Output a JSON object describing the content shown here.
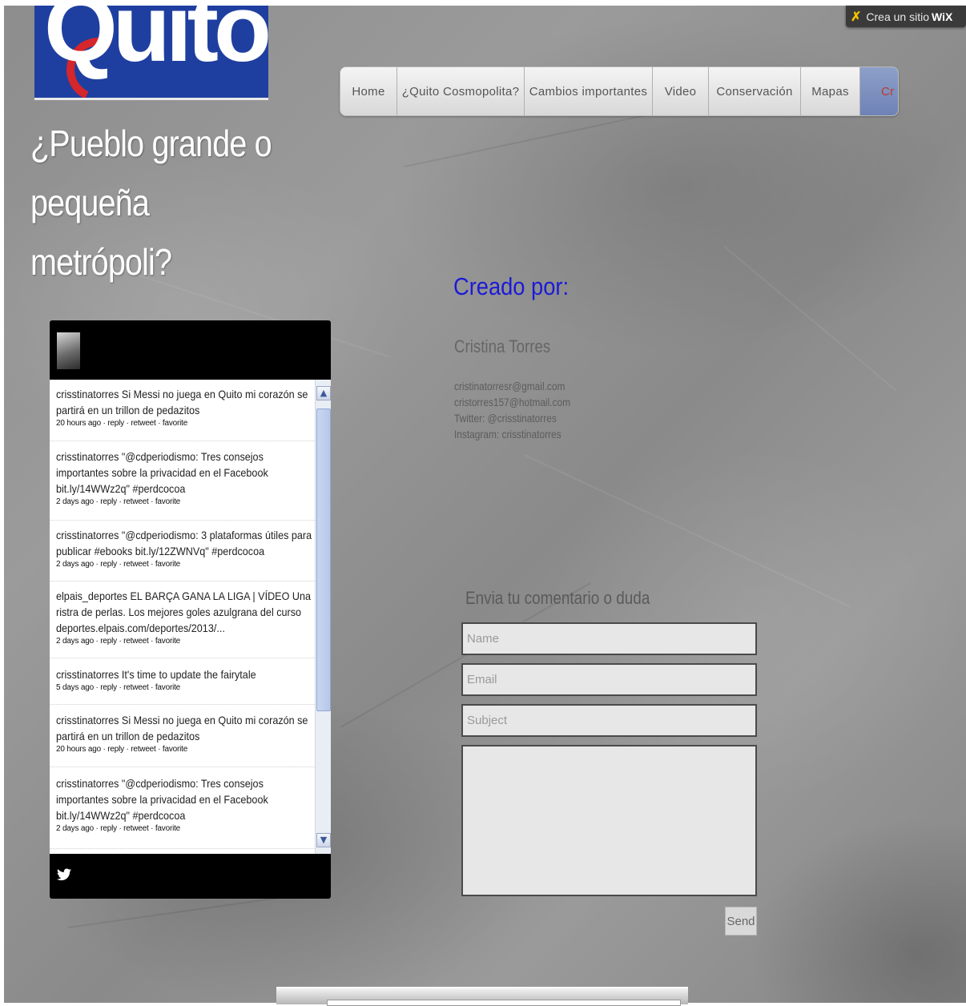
{
  "logo": {
    "text": "Quito"
  },
  "wix_badge": {
    "prefix": "Crea un sitio",
    "brand": "WiX"
  },
  "nav": {
    "items": [
      {
        "label": "Home"
      },
      {
        "label": "¿Quito Cosmopolita?"
      },
      {
        "label": "Cambios importantes"
      },
      {
        "label": "Video"
      },
      {
        "label": "Conservación"
      },
      {
        "label": "Mapas"
      },
      {
        "label": "Cr"
      }
    ]
  },
  "site_title": "¿Pueblo grande o pequeña metrópoli?",
  "twitter": {
    "tweets": [
      {
        "user": "crisstinatorres",
        "text": "Si Messi no juega en Quito mi corazón se partirá en un trillon de pedazitos",
        "meta": "20 hours ago · reply · retweet · favorite"
      },
      {
        "user": "crisstinatorres",
        "text": "\"@cdperiodismo: Tres consejos importantes sobre la privacidad en el Facebook bit.ly/14WWz2q\" #perdcocoa",
        "meta": "2 days ago · reply · retweet · favorite"
      },
      {
        "user": "crisstinatorres",
        "text": "\"@cdperiodismo: 3 plataformas útiles para publicar #ebooks bit.ly/12ZWNVq\" #perdcocoa",
        "meta": "2 days ago · reply · retweet · favorite"
      },
      {
        "user": "elpais_deportes",
        "text": "EL BARÇA GANA LA LIGA | VÍDEO Una ristra de perlas. Los mejores goles azulgrana del curso deportes.elpais.com/deportes/2013/...",
        "meta": "2 days ago · reply · retweet · favorite"
      },
      {
        "user": "crisstinatorres",
        "text": "It's time to update the fairytale",
        "meta": "5 days ago · reply · retweet · favorite"
      },
      {
        "user": "crisstinatorres",
        "text": "Si Messi no juega en Quito mi corazón se partirá en un trillon de pedazitos",
        "meta": "20 hours ago · reply · retweet · favorite"
      },
      {
        "user": "crisstinatorres",
        "text": "\"@cdperiodismo: Tres consejos importantes sobre la privacidad en el Facebook bit.ly/14WWz2q\" #perdcocoa",
        "meta": "2 days ago · reply · retweet · favorite"
      }
    ]
  },
  "creator": {
    "heading": "Creado por:",
    "name": "Cristina Torres",
    "contacts": [
      "cristinatorresr@gmail.com",
      "cristorres157@hotmail.com",
      "Twitter: @crisstinatorres",
      "Instagram: crisstinatorres"
    ]
  },
  "contact_form": {
    "title": "Envia tu comentario o duda",
    "name_placeholder": "Name",
    "email_placeholder": "Email",
    "subject_placeholder": "Subject",
    "send_label": "Send"
  },
  "colors": {
    "heading_blue": "#1b1bd6",
    "logo_blue": "#1f3fa0",
    "logo_red": "#d4262b"
  }
}
